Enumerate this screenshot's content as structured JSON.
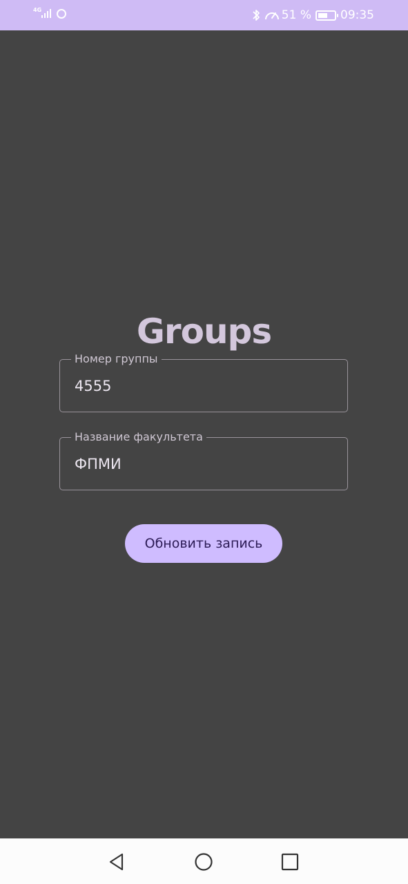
{
  "status_bar": {
    "network_type": "4G",
    "battery_percent": "51 %",
    "battery_level": 0.51,
    "time": "09:35",
    "icons": [
      "signal-icon",
      "sync-icon",
      "bluetooth-icon",
      "speed-icon",
      "battery-charging-icon"
    ]
  },
  "screen": {
    "title": "Groups",
    "fields": [
      {
        "label": "Номер группы",
        "value": "4555"
      },
      {
        "label": "Название факультета",
        "value": "ФПМИ"
      }
    ],
    "button_label": "Обновить запись"
  },
  "nav_bar": {
    "icons": [
      "back-icon",
      "home-icon",
      "recents-icon"
    ]
  },
  "colors": {
    "status_bar_bg": "#cfbbf5",
    "background": "#444444",
    "accent_button": "#cfbcff",
    "button_text": "#2c1b55",
    "title": "#d3c7dc"
  }
}
